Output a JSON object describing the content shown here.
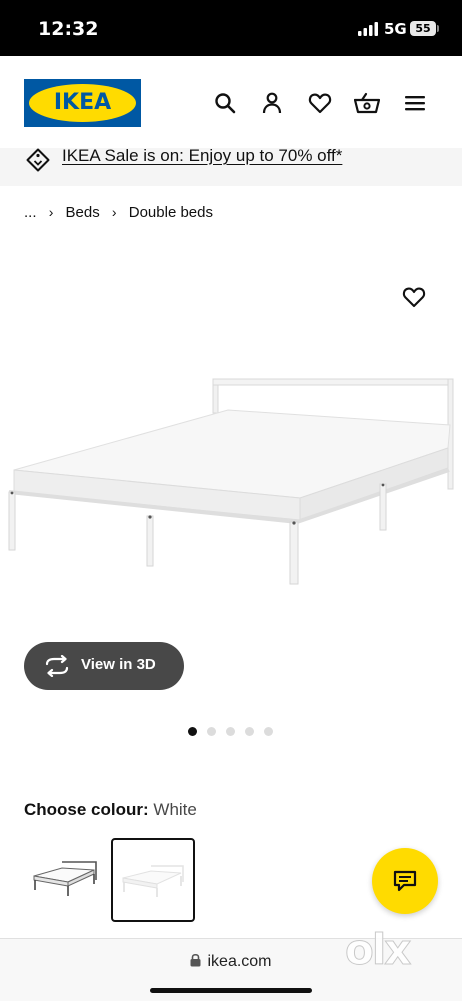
{
  "status_bar": {
    "time": "12:32",
    "network": "5G",
    "battery": "55"
  },
  "header": {
    "logo_text": "IKEA",
    "icons": [
      "search-icon",
      "account-icon",
      "heart-icon",
      "basket-icon",
      "menu-icon"
    ]
  },
  "promo": {
    "text": "IKEA Sale is on: Enjoy up to 70% off*"
  },
  "breadcrumb": {
    "ellipsis": "...",
    "items": [
      "Beds",
      "Double beds"
    ]
  },
  "product": {
    "view_3d_label": "View in 3D",
    "carousel": {
      "total": 5,
      "active_index": 0
    }
  },
  "colour": {
    "label": "Choose colour:",
    "value": "White"
  },
  "browser": {
    "url": "ikea.com"
  },
  "watermark": {
    "text": "olx"
  },
  "colors": {
    "ikea_blue": "#0058a3",
    "ikea_yellow": "#ffdb00",
    "button_dark": "#484848"
  }
}
